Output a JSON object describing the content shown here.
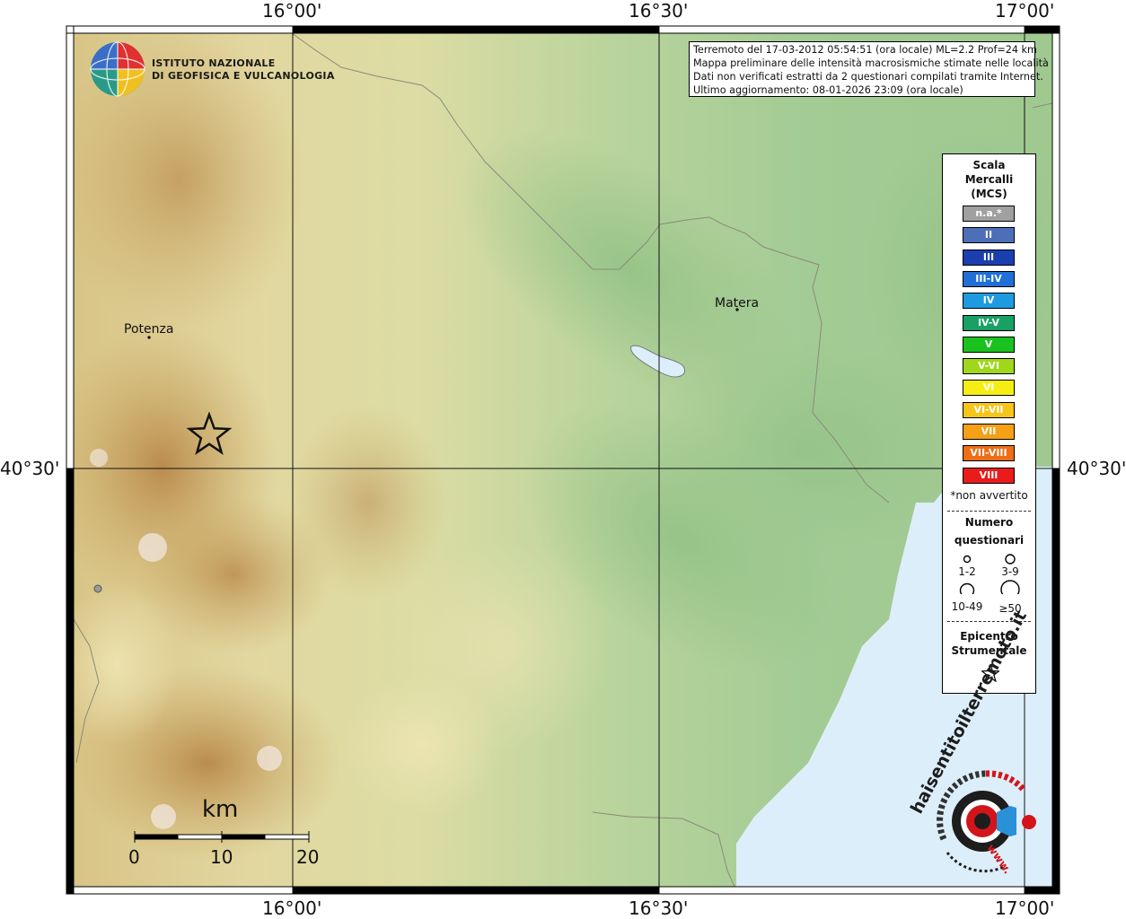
{
  "map": {
    "axes": {
      "top": [
        "16°00'",
        "16°30'",
        "17°00'"
      ],
      "bottom": [
        "16°00'",
        "16°30'",
        "17°00'"
      ],
      "left": [
        "40°30'"
      ],
      "right": [
        "40°30'"
      ]
    },
    "cities": [
      {
        "name": "Potenza"
      },
      {
        "name": "Matera"
      }
    ]
  },
  "institute": {
    "line1": "ISTITUTO NAZIONALE",
    "line2": "DI GEOFISICA E VULCANOLOGIA"
  },
  "info": {
    "line1": "Terremoto del 17-03-2012 05:54:51 (ora locale) ML=2.2 Prof=24 km",
    "line2": "Mappa preliminare delle intensità macrosismiche stimate nelle località",
    "line3": "Dati non verificati estratti da 2 questionari compilati tramite Internet.",
    "line4": "Ultimo aggiornamento: 08-01-2026 23:09 (ora locale)"
  },
  "legend": {
    "scale_title": [
      "Scala",
      "Mercalli",
      "(MCS)"
    ],
    "intensities": [
      {
        "label": "n.a.*",
        "color": "#a0a0a0"
      },
      {
        "label": "II",
        "color": "#4d6fb8"
      },
      {
        "label": "III",
        "color": "#1c3fb0"
      },
      {
        "label": "III-IV",
        "color": "#1f6fd6"
      },
      {
        "label": "IV",
        "color": "#1e9be0"
      },
      {
        "label": "IV-V",
        "color": "#19a065"
      },
      {
        "label": "V",
        "color": "#19c21f"
      },
      {
        "label": "V-VI",
        "color": "#9fd81a"
      },
      {
        "label": "VI",
        "color": "#f6ee13"
      },
      {
        "label": "VI-VII",
        "color": "#f6c519"
      },
      {
        "label": "VII",
        "color": "#f5a015"
      },
      {
        "label": "VII-VIII",
        "color": "#ef6d14"
      },
      {
        "label": "VIII",
        "color": "#e91b1b"
      }
    ],
    "not_felt_note": "*non avvertito",
    "questionnaires_title": [
      "Numero",
      "questionari"
    ],
    "questionnaire_sizes": [
      "1-2",
      "3-9",
      "10-49",
      "≥50"
    ],
    "epicenter_title": [
      "Epicentro",
      "Strumentale"
    ]
  },
  "scalebar": {
    "unit": "km",
    "ticks": [
      "0",
      "10",
      "20"
    ]
  },
  "badge": {
    "text": "haisentitoilterremoto.it",
    "www": "www.",
    "colors": {
      "red": "#d4141b",
      "blue": "#2a90d8"
    }
  },
  "colors": {
    "sea": "#dceefa",
    "lowland": "#a7cc98",
    "hills": "#e3dba0",
    "mountains": "#c29a55"
  }
}
